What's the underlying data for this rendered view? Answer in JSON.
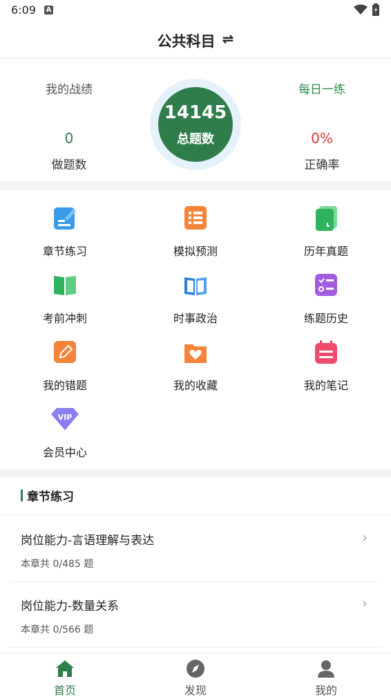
{
  "status": {
    "time": "6:09",
    "indicator": "A"
  },
  "header": {
    "title": "公共科目",
    "switch_icon": "swap-icon"
  },
  "stats": {
    "record_link": "我的战绩",
    "daily_link": "每日一练",
    "done_count": "0",
    "done_label": "做题数",
    "total_count": "14145",
    "total_label": "总题数",
    "accuracy": "0%",
    "accuracy_label": "正确率"
  },
  "grid": [
    {
      "label": "章节练习",
      "icon": "chapter-practice-icon"
    },
    {
      "label": "模拟预测",
      "icon": "mock-test-icon"
    },
    {
      "label": "历年真题",
      "icon": "past-papers-icon"
    },
    {
      "label": "考前冲刺",
      "icon": "book-open-icon"
    },
    {
      "label": "时事政治",
      "icon": "news-book-icon"
    },
    {
      "label": "练题历史",
      "icon": "history-list-icon"
    },
    {
      "label": "我的错题",
      "icon": "pencil-icon"
    },
    {
      "label": "我的收藏",
      "icon": "heart-folder-icon"
    },
    {
      "label": "我的笔记",
      "icon": "notes-icon"
    },
    {
      "label": "会员中心",
      "icon": "vip-diamond-icon"
    }
  ],
  "chapter": {
    "title": "章节练习",
    "rows": [
      {
        "title": "岗位能力-言语理解与表达",
        "sub": "本章共  0/485  题"
      },
      {
        "title": "岗位能力-数量关系",
        "sub": "本章共  0/566  题"
      }
    ]
  },
  "tabs": [
    {
      "label": "首页",
      "icon": "home-icon",
      "active": true
    },
    {
      "label": "发现",
      "icon": "compass-icon",
      "active": false
    },
    {
      "label": "我的",
      "icon": "user-icon",
      "active": false
    }
  ],
  "colors": {
    "accent": "#2f7d4a",
    "red": "#d83a3a"
  }
}
